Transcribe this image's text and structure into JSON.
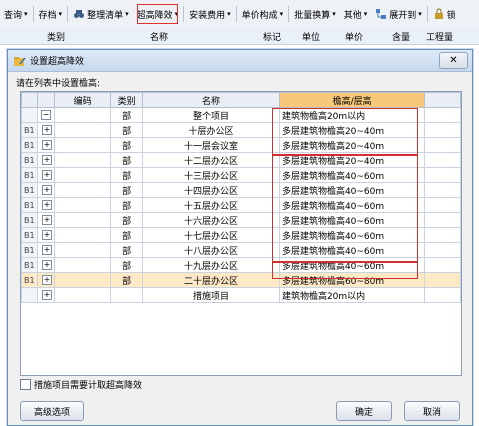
{
  "toolbar": {
    "items": [
      "查询",
      "存档",
      "整理清单",
      "超高降效",
      "安装费用",
      "单价构成",
      "批量换算",
      "其他",
      "展开到",
      "锁"
    ]
  },
  "bg_columns": [
    "类别",
    "名称",
    "标记",
    "单位",
    "单价",
    "含量",
    "工程量"
  ],
  "bg_fragment": "整个项目",
  "dialog": {
    "title": "设置超高降效",
    "prompt": "请在列表中设置檐高:",
    "columns": [
      "编码",
      "类别",
      "名称",
      "檐高/层高"
    ],
    "rows": [
      {
        "idx": "",
        "exp": "−",
        "code": "",
        "cat": "部",
        "name": "整个项目",
        "height": "建筑物檐高20m以内"
      },
      {
        "idx": "B1",
        "exp": "+",
        "code": "",
        "cat": "部",
        "name": "十层办公区",
        "height": "多层建筑物檐高20~40m"
      },
      {
        "idx": "B1",
        "exp": "+",
        "code": "",
        "cat": "部",
        "name": "十一层会议室",
        "height": "多层建筑物檐高20~40m"
      },
      {
        "idx": "B1",
        "exp": "+",
        "code": "",
        "cat": "部",
        "name": "十二层办公区",
        "height": "多层建筑物檐高20~40m"
      },
      {
        "idx": "B1",
        "exp": "+",
        "code": "",
        "cat": "部",
        "name": "十三层办公区",
        "height": "多层建筑物檐高40~60m"
      },
      {
        "idx": "B1",
        "exp": "+",
        "code": "",
        "cat": "部",
        "name": "十四层办公区",
        "height": "多层建筑物檐高40~60m"
      },
      {
        "idx": "B1",
        "exp": "+",
        "code": "",
        "cat": "部",
        "name": "十五层办公区",
        "height": "多层建筑物檐高40~60m"
      },
      {
        "idx": "B1",
        "exp": "+",
        "code": "",
        "cat": "部",
        "name": "十六层办公区",
        "height": "多层建筑物檐高40~60m"
      },
      {
        "idx": "B1",
        "exp": "+",
        "code": "",
        "cat": "部",
        "name": "十七层办公区",
        "height": "多层建筑物檐高40~60m"
      },
      {
        "idx": "B1",
        "exp": "+",
        "code": "",
        "cat": "部",
        "name": "十八层办公区",
        "height": "多层建筑物檐高40~60m"
      },
      {
        "idx": "B1",
        "exp": "+",
        "code": "",
        "cat": "部",
        "name": "十九层办公区",
        "height": "多层建筑物檐高40~60m"
      },
      {
        "idx": "B1",
        "exp": "+",
        "code": "",
        "cat": "部",
        "name": "二十层办公区",
        "height": "多层建筑物檐高60~80m"
      },
      {
        "idx": "",
        "exp": "+",
        "code": "",
        "cat": "",
        "name": "措施项目",
        "height": "建筑物檐高20m以内"
      }
    ],
    "checkbox_label": "措施项目需要计取超高降效",
    "btn_advanced": "高级选项",
    "btn_ok": "确定",
    "btn_cancel": "取消"
  },
  "colors": {
    "highlight_header": "#f7c77a",
    "selected_row": "#fde9c6",
    "red_box": "#d23030"
  }
}
